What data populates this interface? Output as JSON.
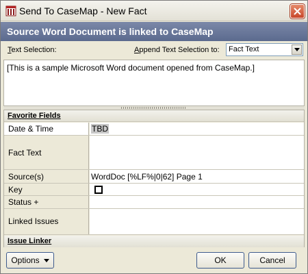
{
  "window": {
    "title": "Send To CaseMap - New Fact",
    "close_label": "×"
  },
  "header": {
    "title": "Source Word Document is linked to CaseMap"
  },
  "selection": {
    "label": "Text Selection:",
    "append_label": "Append Text Selection to:",
    "append_value": "Fact Text",
    "text": "[This is a sample Microsoft Word document opened from CaseMap.]"
  },
  "fields": {
    "group_title": "Favorite Fields",
    "rows": [
      {
        "name": "Date & Time",
        "value": "TBD"
      },
      {
        "name": "Fact Text",
        "value": ""
      },
      {
        "name": "Source(s)",
        "value": "WordDoc [%LF%|0|62] Page 1"
      },
      {
        "name": "Key",
        "value": ""
      },
      {
        "name": "Status +",
        "value": ""
      },
      {
        "name": "Linked Issues",
        "value": ""
      }
    ],
    "key_checked": false
  },
  "issue_linker": {
    "title": "Issue Linker"
  },
  "buttons": {
    "options": "Options",
    "ok": "OK",
    "cancel": "Cancel"
  },
  "icons": {
    "app": "casemap-app-icon",
    "close": "close-icon",
    "dropdown": "chevron-down-icon"
  },
  "colors": {
    "header_band": "#5b6a8e",
    "close_button": "#c8462a",
    "button_border": "#3d5a8c"
  }
}
